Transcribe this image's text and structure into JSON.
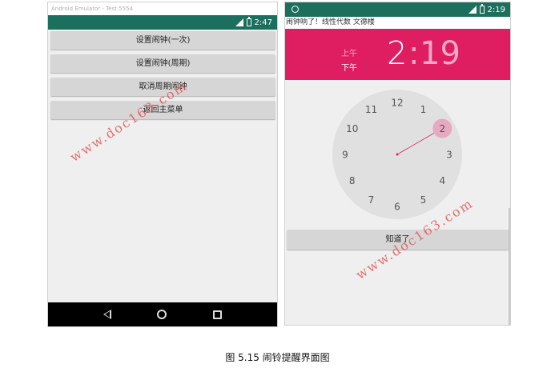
{
  "left_phone": {
    "emulator_title": "Android Emulator - Test:5554",
    "status_time": "2:47",
    "buttons": [
      "设置闹钟(一次)",
      "设置闹钟(周期)",
      "取消周期闹钟",
      "返回主菜单"
    ]
  },
  "right_phone": {
    "status_time": "2:19",
    "title": "闹钟响了！线性代数 文德楼",
    "am_label": "上午",
    "pm_label": "下午",
    "hour": "2",
    "colon": ":",
    "minute": "19",
    "clock_numbers": [
      "12",
      "1",
      "2",
      "3",
      "4",
      "5",
      "6",
      "7",
      "8",
      "9",
      "10",
      "11"
    ],
    "selected_number": "2",
    "dismiss_label": "知道了"
  },
  "watermark": "www.doc163.com",
  "caption": "图 5.15 闹铃提醒界面图",
  "colors": {
    "status_bar": "#1c6e5d",
    "accent_pink": "#df1e62",
    "button_grey": "#d6d6d6",
    "clock_face": "#e0e0e0",
    "watermark": "#e45858"
  }
}
